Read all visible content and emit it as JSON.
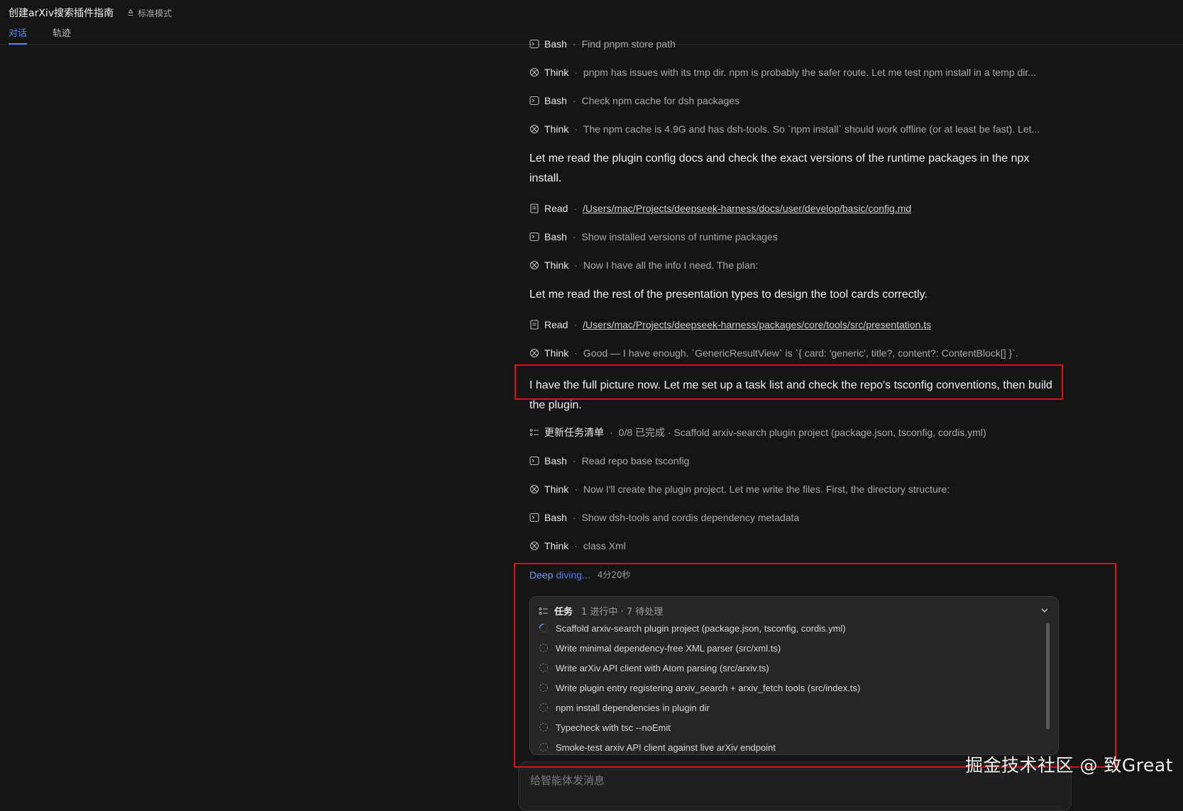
{
  "header": {
    "title": "创建arXiv搜索插件指南",
    "mode": "标准模式",
    "tabs": [
      {
        "label": "对话",
        "active": true
      },
      {
        "label": "轨迹",
        "active": false
      }
    ]
  },
  "colors": {
    "accent": "#5b8def",
    "highlight_box": "#e01010",
    "background": "#151515"
  },
  "timeline": {
    "r0": {
      "icon": "terminal-icon",
      "kind": "Bash",
      "desc": "Find pnpm store path"
    },
    "r1": {
      "icon": "think-icon",
      "kind": "Think",
      "desc": "pnpm has issues with its tmp dir. npm is probably the safer route. Let me test npm install in a temp dir..."
    },
    "r2": {
      "icon": "terminal-icon",
      "kind": "Bash",
      "desc": "Check npm cache for dsh packages"
    },
    "r3": {
      "icon": "think-icon",
      "kind": "Think",
      "desc": "The npm cache is 4.9G and has dsh-tools. So `npm install` should work offline (or at least be fast). Let..."
    },
    "p1": "Let me read the plugin config docs and check the exact versions of the runtime packages in the npx install.",
    "r4": {
      "icon": "file-icon",
      "kind": "Read",
      "desc": "/Users/mac/Projects/deepseek-harness/docs/user/develop/basic/config.md"
    },
    "r5": {
      "icon": "terminal-icon",
      "kind": "Bash",
      "desc": "Show installed versions of runtime packages"
    },
    "r6": {
      "icon": "think-icon",
      "kind": "Think",
      "desc": "Now I have all the info I need. The plan:"
    },
    "p2": "Let me read the rest of the presentation types to design the tool cards correctly.",
    "r7": {
      "icon": "file-icon",
      "kind": "Read",
      "desc": "/Users/mac/Projects/deepseek-harness/packages/core/tools/src/presentation.ts"
    },
    "r8": {
      "icon": "think-icon",
      "kind": "Think",
      "desc": "Good — I have enough. `GenericResultView` is `{ card: 'generic', title?, content?: ContentBlock[] }`."
    },
    "p3": "I have the full picture now. Let me set up a task list and check the repo's tsconfig conventions, then build the plugin.",
    "r9": {
      "icon": "task-list-icon",
      "kind": "更新任务清单",
      "desc": "0/8 已完成 · Scaffold arxiv-search plugin project (package.json, tsconfig, cordis.yml)"
    },
    "r10": {
      "icon": "terminal-icon",
      "kind": "Bash",
      "desc": "Read repo base tsconfig"
    },
    "r11": {
      "icon": "think-icon",
      "kind": "Think",
      "desc": "Now I'll create the plugin project. Let me write the files. First, the directory structure:"
    },
    "r12": {
      "icon": "terminal-icon",
      "kind": "Bash",
      "desc": "Show dsh-tools and cordis dependency metadata"
    },
    "r13": {
      "icon": "think-icon",
      "kind": "Think",
      "desc": "class Xml"
    }
  },
  "status": {
    "word1": "Deep",
    "word2": "diving...",
    "elapsed": "4分20秒"
  },
  "tasks": {
    "label": "任务",
    "meta": "1 进行中 · 7 待处理",
    "items": [
      {
        "text": "Scaffold arxiv-search plugin project (package.json, tsconfig, cordis.yml)",
        "state": "in_progress"
      },
      {
        "text": "Write minimal dependency-free XML parser (src/xml.ts)",
        "state": "pending"
      },
      {
        "text": "Write arXiv API client with Atom parsing (src/arxiv.ts)",
        "state": "pending"
      },
      {
        "text": "Write plugin entry registering arxiv_search + arxiv_fetch tools (src/index.ts)",
        "state": "pending"
      },
      {
        "text": "npm install dependencies in plugin dir",
        "state": "pending"
      },
      {
        "text": "Typecheck with tsc --noEmit",
        "state": "pending"
      },
      {
        "text": "Smoke-test arxiv API client against live arXiv endpoint",
        "state": "pending"
      }
    ]
  },
  "composer": {
    "placeholder": "给智能体发消息"
  },
  "watermark": "掘金技术社区 @ 致Great"
}
